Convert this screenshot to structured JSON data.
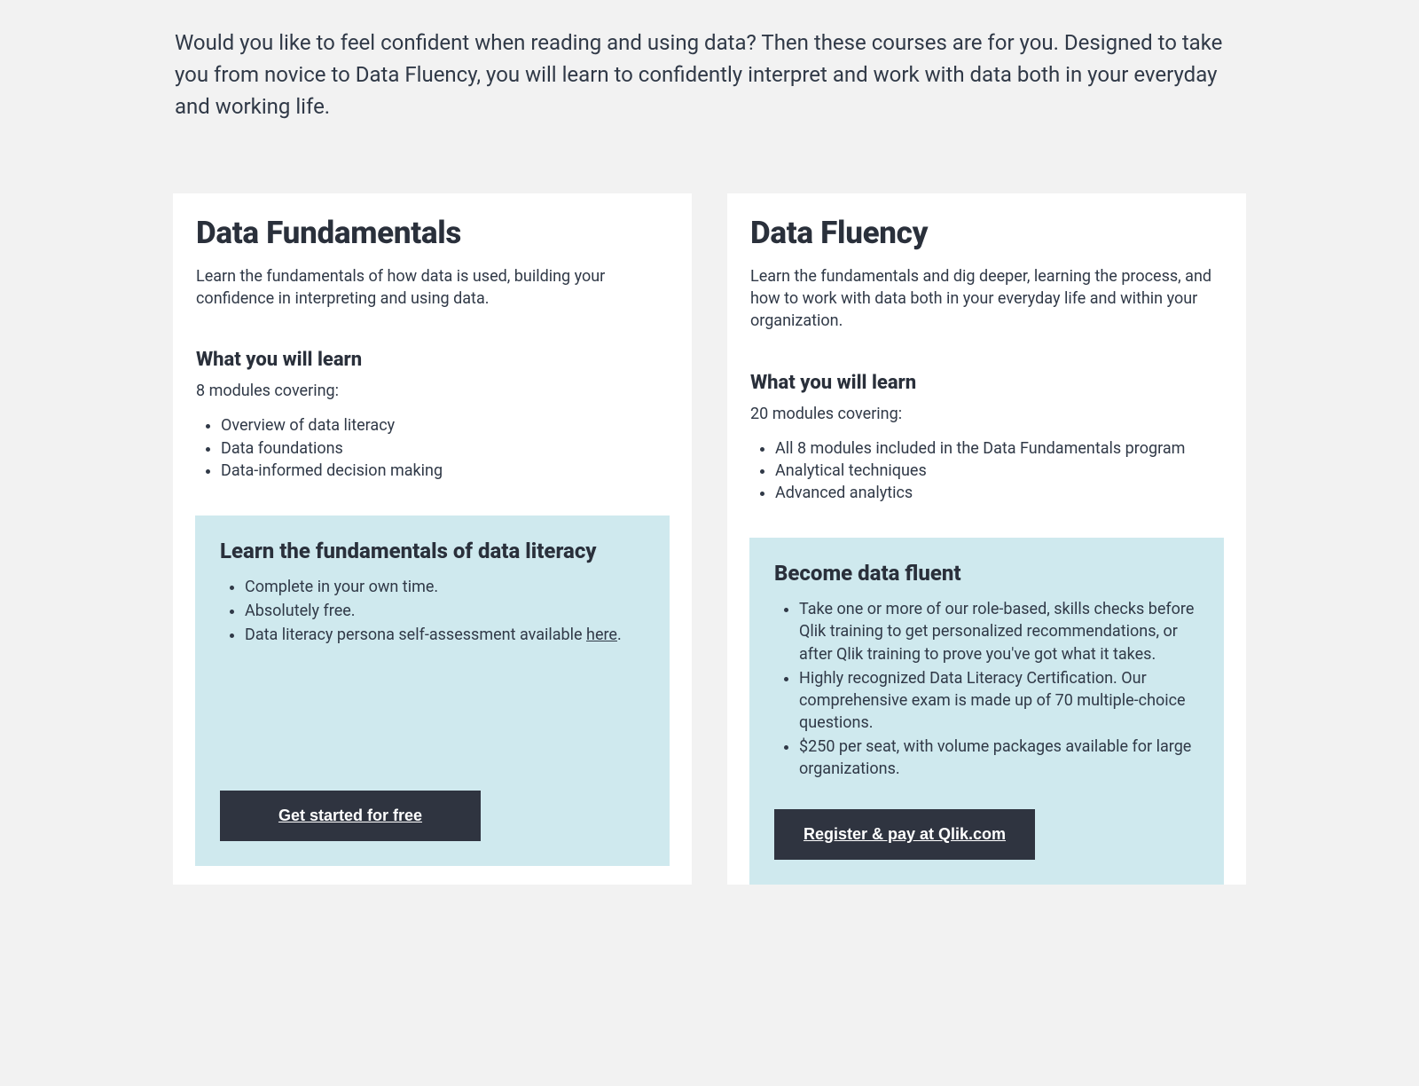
{
  "intro": "Would you like to feel confident when reading and using data? Then these courses are for you. Designed to take you from novice to Data Fluency, you will learn to confidently interpret and work with data both in your everyday and working life.",
  "cards": [
    {
      "title": "Data Fundamentals",
      "description": "Learn the fundamentals of how data is used, building your confidence in interpreting and using data.",
      "learn_heading": "What you will learn",
      "modules_line": "8 modules covering:",
      "modules": [
        "Overview of data literacy",
        "Data foundations",
        "Data-informed decision making"
      ],
      "callout": {
        "title": "Learn the fundamentals of data literacy",
        "items": [
          {
            "text": "Complete in your own time."
          },
          {
            "text": "Absolutely free."
          },
          {
            "text": "Data literacy persona self-assessment available ",
            "link_text": "here",
            "suffix": "."
          }
        ],
        "cta": "Get started for free"
      }
    },
    {
      "title": "Data Fluency",
      "description": "Learn the fundamentals and dig deeper, learning the process, and how to work with data both in your everyday life and within your organization.",
      "learn_heading": "What you will learn",
      "modules_line": "20 modules covering:",
      "modules": [
        "All 8 modules included in the Data Fundamentals program",
        "Analytical techniques",
        "Advanced analytics"
      ],
      "callout": {
        "title": "Become data fluent",
        "items": [
          {
            "text": "Take one or more of our role-based, skills checks before Qlik training to get personalized recommendations, or after Qlik training to prove you've got what it takes."
          },
          {
            "text": "Highly recognized Data Literacy Certification. Our comprehensive exam is made up of 70 multiple-choice questions."
          },
          {
            "text": "$250 per seat, with volume packages available for large organizations."
          }
        ],
        "cta": "Register & pay at Qlik.com"
      }
    }
  ]
}
